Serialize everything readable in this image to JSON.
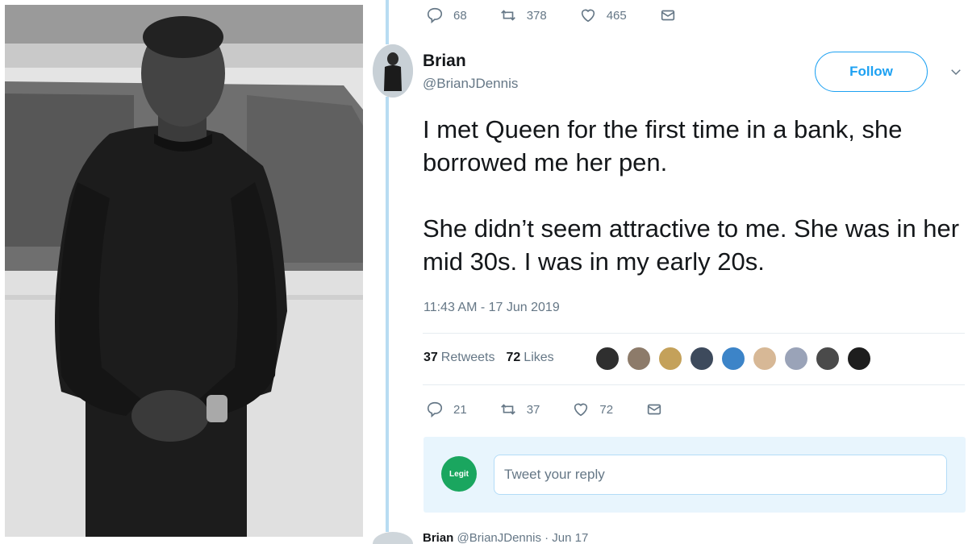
{
  "top_actions": {
    "replies": "68",
    "retweets": "378",
    "likes": "465"
  },
  "tweet": {
    "author_name": "Brian",
    "author_handle": "@BrianJDennis",
    "follow_label": "Follow",
    "paragraphs": [
      "I met Queen for the first time in a bank, she borrowed me her pen.",
      "She didn’t seem attractive to me. She was in her mid 30s. I was in my early 20s."
    ],
    "timestamp": "11:43 AM - 17 Jun 2019",
    "retweets_count": "37",
    "retweets_label": "Retweets",
    "likes_count": "72",
    "likes_label": "Likes"
  },
  "tweet_actions": {
    "replies": "21",
    "retweets": "37",
    "likes": "72"
  },
  "reply": {
    "avatar_text": "Legit",
    "placeholder": "Tweet your reply"
  },
  "next_tweet": {
    "name": "Brian",
    "handle": "@BrianJDennis · Jun 17"
  },
  "colors": {
    "accent": "#1da1f2",
    "thread_line": "#b8dcf2",
    "muted_text": "#657786",
    "reply_bg": "#e8f5fd",
    "legit_green": "#1aa65f"
  },
  "icons": [
    "reply-icon",
    "retweet-icon",
    "like-icon",
    "dm-icon",
    "chevron-down-icon"
  ]
}
